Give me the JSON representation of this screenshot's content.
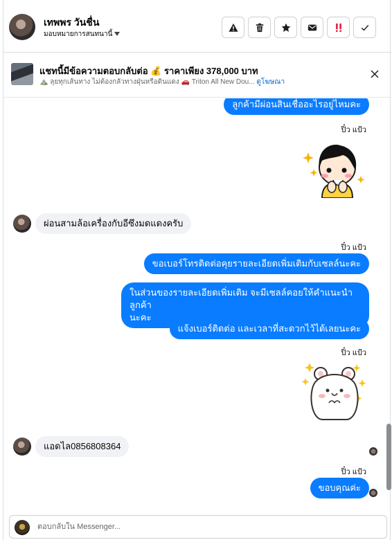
{
  "header": {
    "contact_name": "เทพพร วันชื่น",
    "assign_label": "มอบหมายการสนทนานี้",
    "buttons": [
      {
        "name": "spam-button",
        "icon": "warning-icon"
      },
      {
        "name": "delete-button",
        "icon": "trash-icon"
      },
      {
        "name": "star-button",
        "icon": "star-icon"
      },
      {
        "name": "mark-unread-button",
        "icon": "envelope-icon"
      },
      {
        "name": "follow-up-button",
        "icon": "double-exclamation-icon",
        "color": "#e41e3f"
      },
      {
        "name": "mark-done-button",
        "icon": "check-icon"
      }
    ]
  },
  "promo": {
    "title": "แชทนี้มีข้อความตอบกลับต่อ 💰 ราคาเพียง 378,000 บาท",
    "subtitle": "⛰️ ลุยทุกเส้นทาง ไม่ต้องกลัวทางฝุ่นหรือดินแดง 🚗 Triton All New Dou...",
    "link": "ดูโฆษณา"
  },
  "messages": {
    "m1": "ลูกค้ามีผ่อนสินเชื่ออะไรอยู่ไหมคะ",
    "sender1": "ปิ๋ว แป้ว",
    "m2": "ผ่อนสามล้อเครื่องกับอีซึงมดแดงครับ",
    "sender2": "ปิ๋ว แป้ว",
    "m3": "ขอเบอร์โทรติดต่อคุยรายละเอียดเพิ่มเติมกับเซลล์นะคะ",
    "m4_line1": "ในส่วนของรายละเอียดเพิ่มเติม จะมีเซลล์คอยให้คำแนะนำ ลูกค้า",
    "m4_line2": "นะคะ",
    "m5": "แจ้งเบอร์ติดต่อ  และเวลาที่สะดวกไว้ได้เลยนะคะ",
    "sender3": "ปิ๋ว แป้ว",
    "m6": "แอดไล0856808364",
    "sender4": "ปิ๋ว แป้ว",
    "m7": "ขอบคุณค่ะ"
  },
  "composer": {
    "placeholder": "ตอบกลับใน Messenger..."
  },
  "colors": {
    "outgoing_bubble": "#0a7cff",
    "incoming_bubble": "#f0f2f5",
    "link": "#0064d1"
  }
}
